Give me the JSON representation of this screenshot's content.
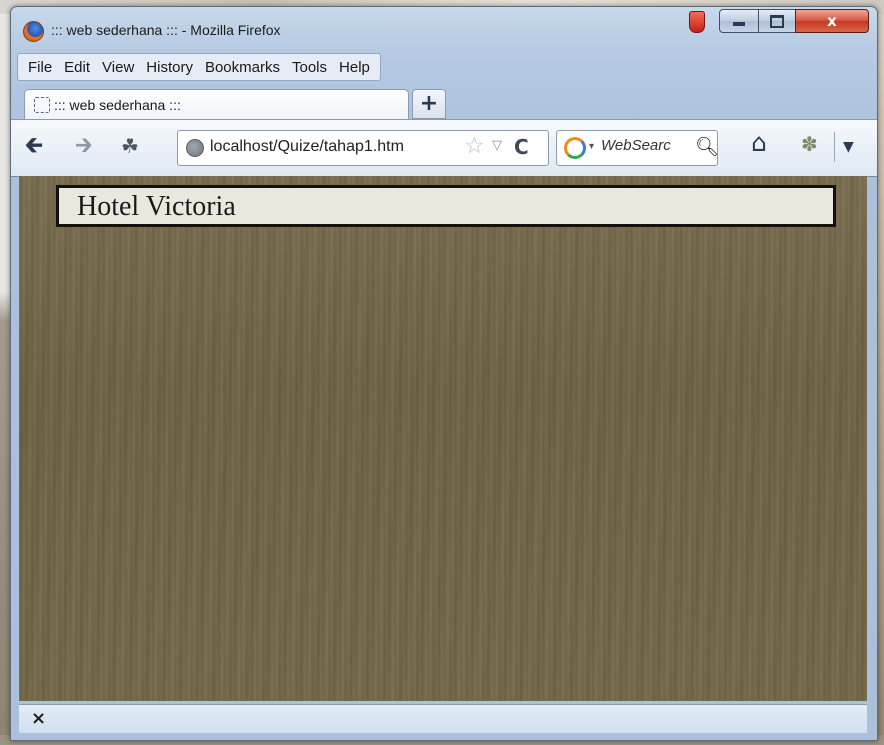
{
  "window": {
    "title": "::: web sederhana ::: - Mozilla Firefox",
    "controls": {
      "minimize": "minimize-icon",
      "maximize": "maximize-icon",
      "close": "x"
    }
  },
  "menubar": {
    "items": [
      "File",
      "Edit",
      "View",
      "History",
      "Bookmarks",
      "Tools",
      "Help"
    ]
  },
  "tabs": [
    {
      "label": "::: web sederhana :::",
      "active": true
    }
  ],
  "new_tab_label": "+",
  "navbar": {
    "url": "localhost/Quize/tahap1.htm",
    "search_placeholder": "WebSearc"
  },
  "page": {
    "header_title": "Hotel Victoria"
  },
  "statusbar": {
    "close_label": "×"
  },
  "colors": {
    "content_background": "#756848",
    "header_box_background": "#eae7df",
    "header_box_border": "#111111",
    "close_button": "#c53a22"
  },
  "icons": {
    "app": "firefox-logo-icon",
    "back": "back-arrow-icon",
    "forward": "forward-arrow-icon",
    "identity": "identity-icon",
    "site": "globe-icon",
    "bookmark": "star-icon",
    "reload": "reload-icon",
    "search_engine": "search-engine-icon",
    "search": "magnifier-icon",
    "home": "home-icon",
    "addon": "addon-icon"
  }
}
